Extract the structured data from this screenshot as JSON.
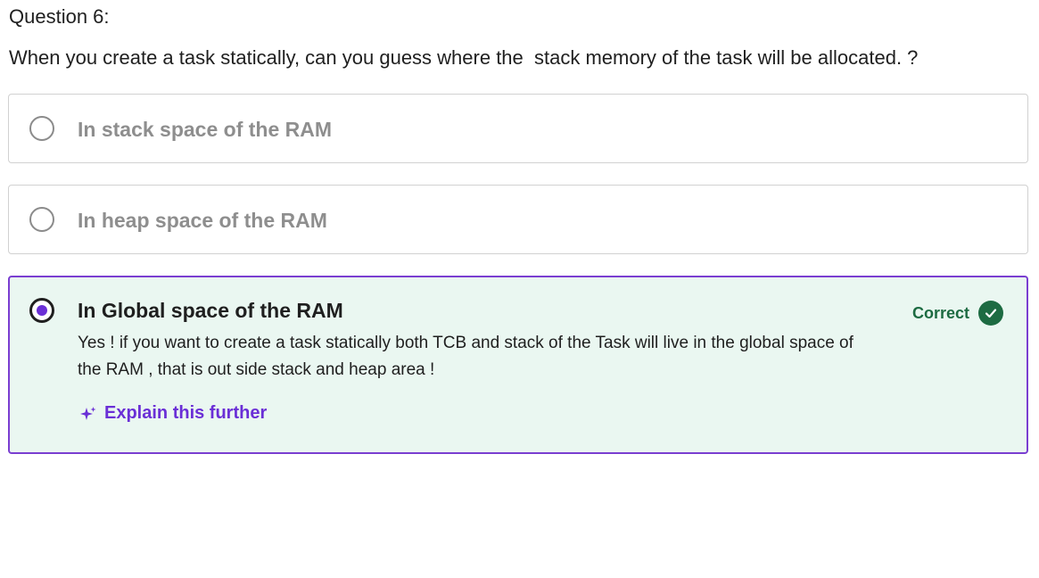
{
  "question": {
    "number_label": "Question 6:",
    "text": "When you create a task statically, can you guess where the  stack memory of the task will be allocated. ?"
  },
  "options": [
    {
      "label": "In stack space of the RAM",
      "selected": false
    },
    {
      "label": "In heap space of the RAM",
      "selected": false
    },
    {
      "label": "In Global space of the RAM",
      "selected": true,
      "status": "Correct",
      "feedback": "Yes ! if you want to create a task statically both TCB and stack of the Task will live in the global space of the RAM , that is out side stack and heap area !",
      "explain_label": "Explain this further"
    }
  ],
  "colors": {
    "accent_purple": "#6a2fd6",
    "selected_border": "#7a3ed1",
    "correct_bg": "#eaf7f1",
    "correct_green": "#1d6b42",
    "unselected_text": "#8e8e8e"
  },
  "icons": {
    "correct": "check-circle-icon",
    "explain": "sparkle-icon"
  }
}
